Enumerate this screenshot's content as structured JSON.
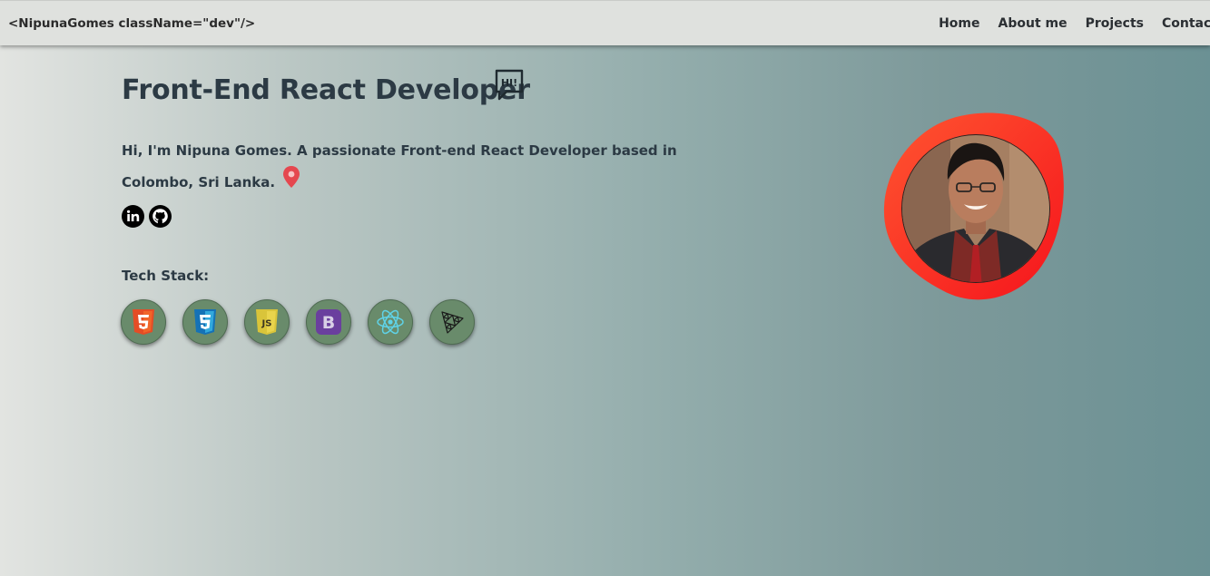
{
  "navbar": {
    "brand": "<NipunaGomes className=\"dev\"/>",
    "links": [
      "Home",
      "About me",
      "Projects",
      "Contact"
    ]
  },
  "hero": {
    "title": "Front-End React Developer",
    "intro": "Hi, I'm Nipuna Gomes. A passionate Front-end React Developer based in Colombo, Sri Lanka.",
    "hi_icon": "hi-speech-bubble-icon",
    "location_icon": "map-pin-icon",
    "pin_color": "#e5474f"
  },
  "socials": [
    {
      "name": "linkedin-icon"
    },
    {
      "name": "github-icon"
    }
  ],
  "tech_stack": {
    "label": "Tech Stack:",
    "items": [
      {
        "icon": "html5-icon",
        "color": "#e44d26"
      },
      {
        "icon": "css3-icon",
        "color": "#1572b6"
      },
      {
        "icon": "javascript-icon",
        "color": "#d9c43a"
      },
      {
        "icon": "bootstrap-icon",
        "color": "#6a3f9e"
      },
      {
        "icon": "react-icon",
        "color": "#5fd3e8"
      },
      {
        "icon": "threejs-icon",
        "color": "#1a1a1a"
      }
    ]
  },
  "colors": {
    "blob_accent": "#ff3a24",
    "tech_bubble": "#698b6b",
    "navbar_bg": "#dfe1de"
  }
}
